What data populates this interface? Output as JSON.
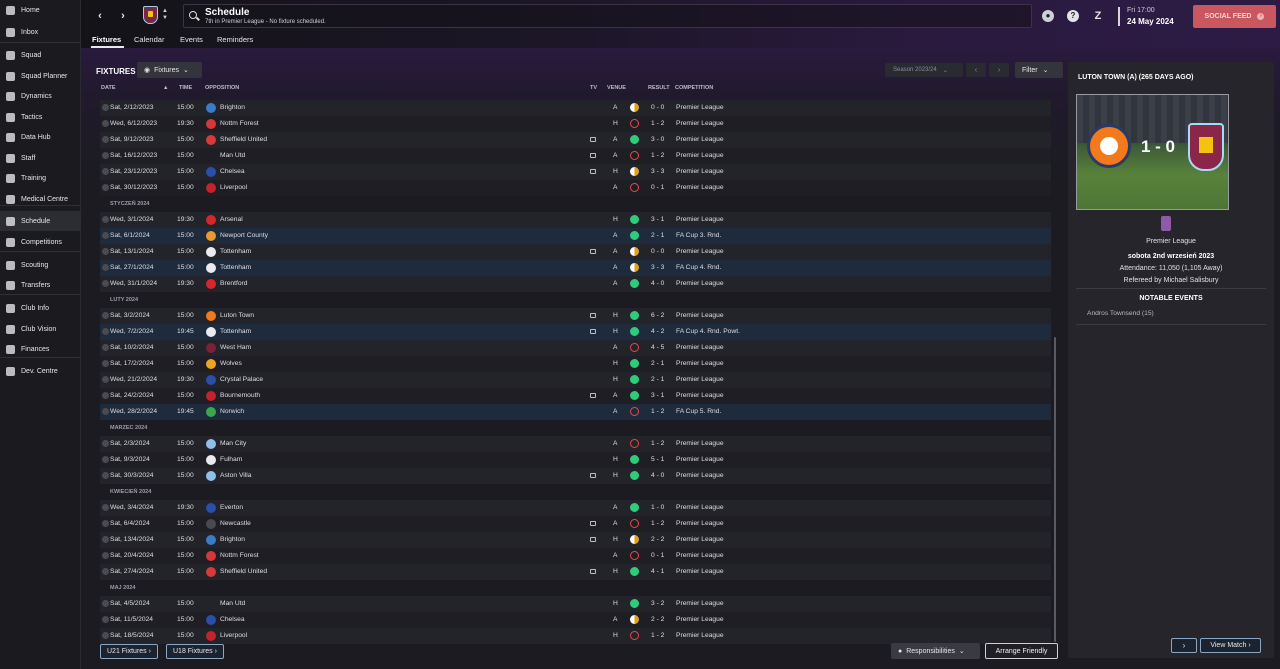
{
  "sidebar": {
    "items": [
      {
        "label": "Home",
        "icon": "home-icon"
      },
      {
        "label": "Inbox",
        "icon": "inbox-icon"
      },
      {
        "label": "Squad",
        "icon": "shirt-icon"
      },
      {
        "label": "Squad Planner",
        "icon": "planner-icon"
      },
      {
        "label": "Dynamics",
        "icon": "dynamics-icon"
      },
      {
        "label": "Tactics",
        "icon": "tactics-icon"
      },
      {
        "label": "Data Hub",
        "icon": "data-hub-icon"
      },
      {
        "label": "Staff",
        "icon": "staff-icon"
      },
      {
        "label": "Training",
        "icon": "training-icon"
      },
      {
        "label": "Medical Centre",
        "icon": "medical-icon"
      },
      {
        "label": "Schedule",
        "icon": "calendar-icon"
      },
      {
        "label": "Competitions",
        "icon": "trophy-icon"
      },
      {
        "label": "Scouting",
        "icon": "scouting-icon"
      },
      {
        "label": "Transfers",
        "icon": "transfers-icon"
      },
      {
        "label": "Club Info",
        "icon": "shield-icon"
      },
      {
        "label": "Club Vision",
        "icon": "vision-icon"
      },
      {
        "label": "Finances",
        "icon": "finances-icon"
      },
      {
        "label": "Dev. Centre",
        "icon": "dev-centre-icon"
      }
    ]
  },
  "header": {
    "title": "Schedule",
    "subtitle": "7th in Premier League - No fixture scheduled.",
    "date_time": "Fri 17:00",
    "date_day": "24 May 2024",
    "social_label": "SOCIAL FEED"
  },
  "tabs": [
    "Fixtures",
    "Calendar",
    "Events",
    "Reminders"
  ],
  "toolbar": {
    "heading": "FIXTURES",
    "view_label": "Fixtures",
    "season": "Season 2023/24",
    "filter": "Filter"
  },
  "columns": {
    "date": "DATE",
    "time": "TIME",
    "opposition": "OPPOSITION",
    "tv": "TV",
    "venue": "VENUE",
    "result": "RESULT",
    "competition": "COMPETITION"
  },
  "rows": [
    {
      "date": "Sat, 2/12/2023",
      "time": "15:00",
      "opp": "Brighton",
      "crest": "#3a7cc8",
      "tv": false,
      "venue": "A",
      "res": "D",
      "score": "0 - 0",
      "comp": "Premier League"
    },
    {
      "date": "Wed, 6/12/2023",
      "time": "19:30",
      "opp": "Nottm Forest",
      "crest": "#d8363b",
      "tv": false,
      "venue": "H",
      "res": "L",
      "score": "1 - 2",
      "comp": "Premier League"
    },
    {
      "date": "Sat, 9/12/2023",
      "time": "15:00",
      "opp": "Sheffield United",
      "crest": "#d83a3a",
      "tv": true,
      "venue": "A",
      "res": "W",
      "score": "3 - 0",
      "comp": "Premier League"
    },
    {
      "date": "Sat, 16/12/2023",
      "time": "15:00",
      "opp": "Man Utd",
      "crest": "",
      "tv": true,
      "venue": "A",
      "res": "L",
      "score": "1 - 2",
      "comp": "Premier League"
    },
    {
      "date": "Sat, 23/12/2023",
      "time": "15:00",
      "opp": "Chelsea",
      "crest": "#2a4fa8",
      "tv": true,
      "venue": "H",
      "res": "D",
      "score": "3 - 3",
      "comp": "Premier League"
    },
    {
      "date": "Sat, 30/12/2023",
      "time": "15:00",
      "opp": "Liverpool",
      "crest": "#c8202e",
      "tv": false,
      "venue": "A",
      "res": "L",
      "score": "0 - 1",
      "comp": "Premier League"
    },
    {
      "month": "STYCZEŃ 2024"
    },
    {
      "date": "Wed, 3/1/2024",
      "time": "19:30",
      "opp": "Arsenal",
      "crest": "#d8262e",
      "tv": false,
      "venue": "H",
      "res": "W",
      "score": "3 - 1",
      "comp": "Premier League"
    },
    {
      "date": "Sat, 6/1/2024",
      "time": "15:00",
      "opp": "Newport County",
      "crest": "#e89a2a",
      "tv": false,
      "venue": "A",
      "res": "W",
      "score": "2 - 1",
      "comp": "FA Cup 3. Rnd.",
      "cup": true
    },
    {
      "date": "Sat, 13/1/2024",
      "time": "15:00",
      "opp": "Tottenham",
      "crest": "#eaeaf0",
      "tv": true,
      "venue": "A",
      "res": "D",
      "score": "0 - 0",
      "comp": "Premier League"
    },
    {
      "date": "Sat, 27/1/2024",
      "time": "15:00",
      "opp": "Tottenham",
      "crest": "#eaeaf0",
      "tv": false,
      "venue": "A",
      "res": "D",
      "score": "3 - 3",
      "comp": "FA Cup 4. Rnd.",
      "cup": true
    },
    {
      "date": "Wed, 31/1/2024",
      "time": "19:30",
      "opp": "Brentford",
      "crest": "#d8262e",
      "tv": false,
      "venue": "A",
      "res": "W",
      "score": "4 - 0",
      "comp": "Premier League"
    },
    {
      "month": "LUTY 2024"
    },
    {
      "date": "Sat, 3/2/2024",
      "time": "15:00",
      "opp": "Luton Town",
      "crest": "#f27a1a",
      "tv": true,
      "venue": "H",
      "res": "W",
      "score": "6 - 2",
      "comp": "Premier League"
    },
    {
      "date": "Wed, 7/2/2024",
      "time": "19:45",
      "opp": "Tottenham",
      "crest": "#eaeaf0",
      "tv": true,
      "venue": "H",
      "res": "W",
      "score": "4 - 2",
      "comp": "FA Cup 4. Rnd. Powt.",
      "cup": true
    },
    {
      "date": "Sat, 10/2/2024",
      "time": "15:00",
      "opp": "West Ham",
      "crest": "#7a2338",
      "tv": false,
      "venue": "A",
      "res": "L",
      "score": "4 - 5",
      "comp": "Premier League"
    },
    {
      "date": "Sat, 17/2/2024",
      "time": "15:00",
      "opp": "Wolves",
      "crest": "#f0a520",
      "tv": false,
      "venue": "H",
      "res": "W",
      "score": "2 - 1",
      "comp": "Premier League"
    },
    {
      "date": "Wed, 21/2/2024",
      "time": "19:30",
      "opp": "Crystal Palace",
      "crest": "#2a4fa8",
      "tv": false,
      "venue": "H",
      "res": "W",
      "score": "2 - 1",
      "comp": "Premier League"
    },
    {
      "date": "Sat, 24/2/2024",
      "time": "15:00",
      "opp": "Bournemouth",
      "crest": "#c8202e",
      "tv": true,
      "venue": "A",
      "res": "W",
      "score": "3 - 1",
      "comp": "Premier League"
    },
    {
      "date": "Wed, 28/2/2024",
      "time": "19:45",
      "opp": "Norwich",
      "crest": "#3aa84a",
      "tv": false,
      "venue": "A",
      "res": "L",
      "score": "1 - 2",
      "comp": "FA Cup 5. Rnd.",
      "cup": true
    },
    {
      "month": "MARZEC 2024"
    },
    {
      "date": "Sat, 2/3/2024",
      "time": "15:00",
      "opp": "Man City",
      "crest": "#8ec0e8",
      "tv": false,
      "venue": "A",
      "res": "L",
      "score": "1 - 2",
      "comp": "Premier League"
    },
    {
      "date": "Sat, 9/3/2024",
      "time": "15:00",
      "opp": "Fulham",
      "crest": "#eaeaf0",
      "tv": false,
      "venue": "H",
      "res": "W",
      "score": "5 - 1",
      "comp": "Premier League"
    },
    {
      "date": "Sat, 30/3/2024",
      "time": "15:00",
      "opp": "Aston Villa",
      "crest": "#8ec0e8",
      "tv": true,
      "venue": "H",
      "res": "W",
      "score": "4 - 0",
      "comp": "Premier League"
    },
    {
      "month": "KWIECIEŃ 2024"
    },
    {
      "date": "Wed, 3/4/2024",
      "time": "19:30",
      "opp": "Everton",
      "crest": "#2a4fa8",
      "tv": false,
      "venue": "A",
      "res": "W",
      "score": "1 - 0",
      "comp": "Premier League"
    },
    {
      "date": "Sat, 6/4/2024",
      "time": "15:00",
      "opp": "Newcastle",
      "crest": "#4a4a4a",
      "tv": true,
      "venue": "A",
      "res": "L",
      "score": "1 - 2",
      "comp": "Premier League"
    },
    {
      "date": "Sat, 13/4/2024",
      "time": "15:00",
      "opp": "Brighton",
      "crest": "#3a7cc8",
      "tv": true,
      "venue": "H",
      "res": "D",
      "score": "2 - 2",
      "comp": "Premier League"
    },
    {
      "date": "Sat, 20/4/2024",
      "time": "15:00",
      "opp": "Nottm Forest",
      "crest": "#d8363b",
      "tv": false,
      "venue": "A",
      "res": "L",
      "score": "0 - 1",
      "comp": "Premier League"
    },
    {
      "date": "Sat, 27/4/2024",
      "time": "15:00",
      "opp": "Sheffield United",
      "crest": "#d83a3a",
      "tv": true,
      "venue": "H",
      "res": "W",
      "score": "4 - 1",
      "comp": "Premier League"
    },
    {
      "month": "MAJ 2024"
    },
    {
      "date": "Sat, 4/5/2024",
      "time": "15:00",
      "opp": "Man Utd",
      "crest": "",
      "tv": false,
      "venue": "H",
      "res": "W",
      "score": "3 - 2",
      "comp": "Premier League"
    },
    {
      "date": "Sat, 11/5/2024",
      "time": "15:00",
      "opp": "Chelsea",
      "crest": "#2a4fa8",
      "tv": false,
      "venue": "A",
      "res": "D",
      "score": "2 - 2",
      "comp": "Premier League"
    },
    {
      "date": "Sat, 18/5/2024",
      "time": "15:00",
      "opp": "Liverpool",
      "crest": "#c8202e",
      "tv": false,
      "venue": "H",
      "res": "L",
      "score": "1 - 2",
      "comp": "Premier League"
    }
  ],
  "footer": {
    "u21": "U21 Fixtures",
    "u18": "U18 Fixtures",
    "responsibilities": "Responsibilities",
    "arrange": "Arrange Friendly"
  },
  "panel": {
    "title": "LUTON TOWN (A) (265 DAYS AGO)",
    "score": "1 - 0",
    "competition": "Premier League",
    "date": "sobota 2nd wrzesień 2023",
    "attendance": "Attendance: 11,050 (1,105 Away)",
    "referee": "Refereed by  Michael Salisbury",
    "notable_heading": "NOTABLE EVENTS",
    "event": "Andros Townsend (15)",
    "view_match": "View Match"
  },
  "colors": {
    "win": "#2ecc7a",
    "loss": "#e44b4b",
    "draw": "#e0a020",
    "accent": "#c8575f",
    "cup_row": "#1e2b3d"
  }
}
